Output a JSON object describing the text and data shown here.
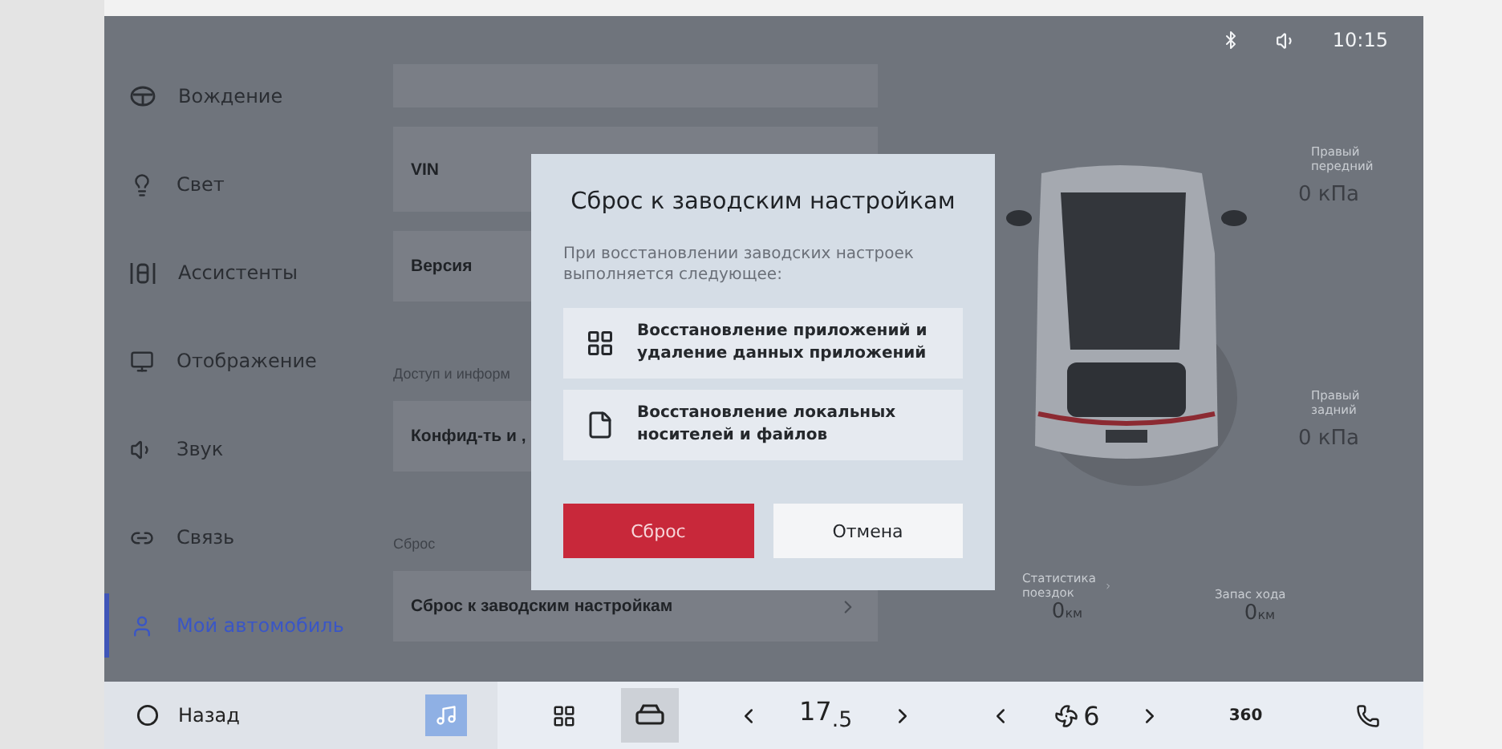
{
  "status_bar": {
    "time": "10:15"
  },
  "sidebar": {
    "items": [
      {
        "label": "Вождение",
        "selected": false
      },
      {
        "label": "Свет",
        "selected": false
      },
      {
        "label": "Ассистенты",
        "selected": false
      },
      {
        "label": "Отображение",
        "selected": false
      },
      {
        "label": "Звук",
        "selected": false
      },
      {
        "label": "Связь",
        "selected": false
      },
      {
        "label": "Мой автомобиль",
        "selected": true
      }
    ]
  },
  "settings_list": [
    {
      "kind": "blank"
    },
    {
      "kind": "item",
      "label": "VIN"
    },
    {
      "kind": "item",
      "label": "Версия"
    },
    {
      "kind": "heading",
      "label": "Доступ и информ"
    },
    {
      "kind": "item",
      "label": "Конфид-ть и ,"
    },
    {
      "kind": "heading",
      "label": "Сброс"
    },
    {
      "kind": "item",
      "label": "Сброс к заводским настройкам",
      "chevron": true
    }
  ],
  "vehicle": {
    "tires": [
      {
        "label": "Правый передний",
        "value": "0 кПа"
      },
      {
        "label": "Правый задний",
        "value": "0 кПа"
      }
    ],
    "stats": [
      {
        "label": "Статистика поездок",
        "value": "0",
        "unit": "км",
        "chevron": true
      },
      {
        "label": "Запас хода",
        "value": "0",
        "unit": "км",
        "chevron": false
      }
    ]
  },
  "dialog": {
    "title": "Сброс к заводским настройкам",
    "description": "При восстановлении заводских настроек выполняется следующее:",
    "items": [
      {
        "kind": "apps",
        "text": "Восстановление приложений и удаление данных приложений"
      },
      {
        "kind": "files",
        "text": "Восстановление локальных носителей и файлов"
      }
    ],
    "buttons": [
      {
        "label": "Сброс",
        "kind": "primary"
      },
      {
        "label": "Отмена",
        "kind": "secondary"
      }
    ]
  },
  "dock": {
    "back": "Назад",
    "car_selected": true,
    "temperature": "17$_{.5}$",
    "fan_level": "6",
    "view_label": "360"
  }
}
